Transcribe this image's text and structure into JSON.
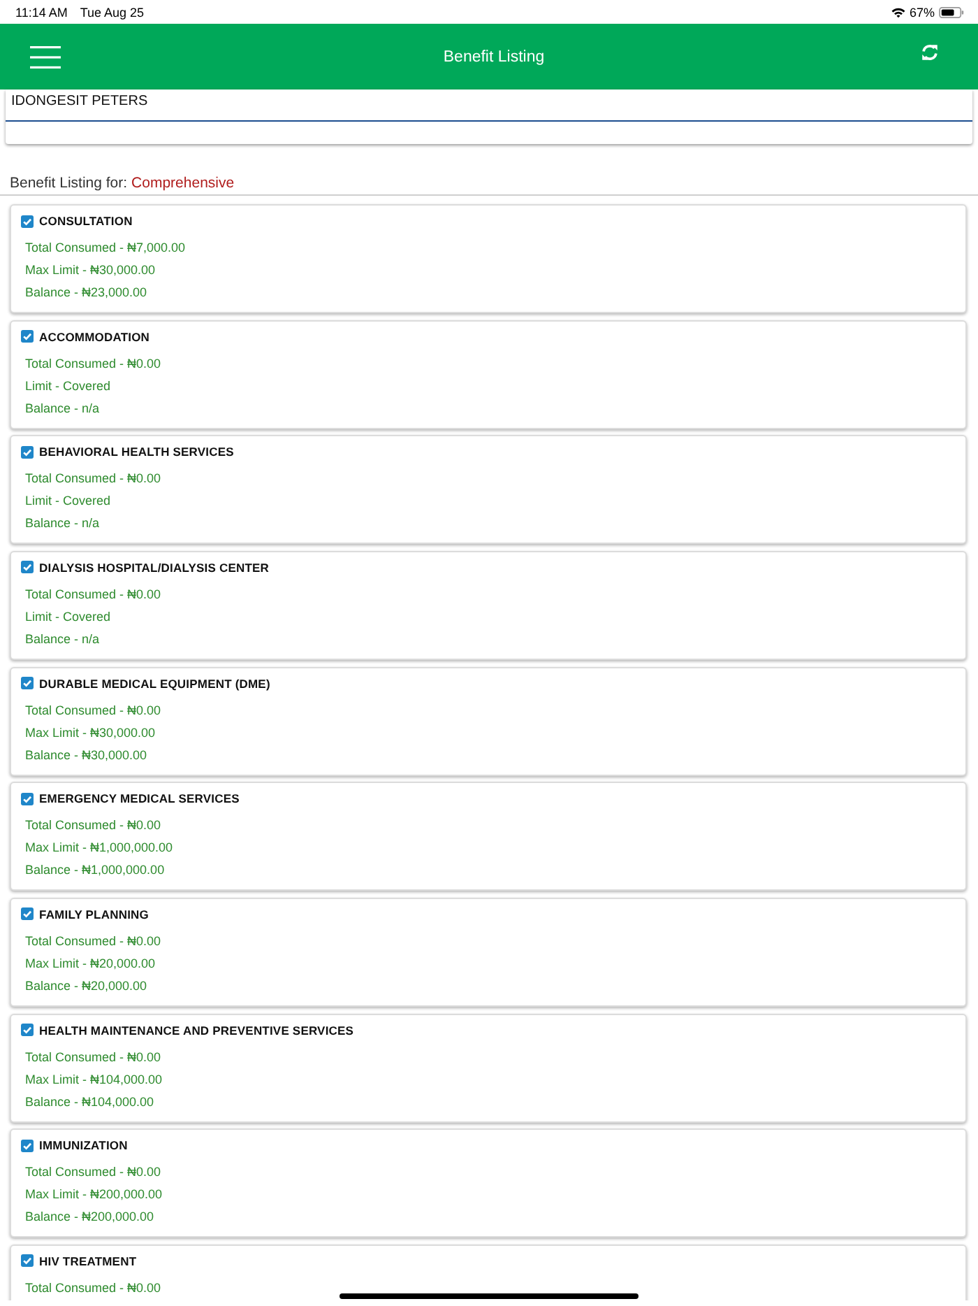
{
  "status_bar": {
    "time": "11:14 AM",
    "date": "Tue Aug 25",
    "battery": "67%"
  },
  "header": {
    "title": "Benefit Listing"
  },
  "member": {
    "name": "IDONGESIT PETERS"
  },
  "plan": {
    "label": "Benefit Listing for:",
    "value": "Comprehensive"
  },
  "benefits": [
    {
      "title": "CONSULTATION",
      "checked": true,
      "lines": [
        "Total Consumed - ₦7,000.00",
        "Max Limit - ₦30,000.00",
        "Balance - ₦23,000.00"
      ]
    },
    {
      "title": "ACCOMMODATION",
      "checked": true,
      "lines": [
        "Total Consumed - ₦0.00",
        "Limit - Covered",
        "Balance - n/a"
      ]
    },
    {
      "title": "BEHAVIORAL HEALTH SERVICES",
      "checked": true,
      "lines": [
        "Total Consumed - ₦0.00",
        "Limit - Covered",
        "Balance - n/a"
      ]
    },
    {
      "title": "DIALYSIS HOSPITAL/DIALYSIS CENTER",
      "checked": true,
      "lines": [
        "Total Consumed - ₦0.00",
        "Limit - Covered",
        "Balance - n/a"
      ]
    },
    {
      "title": "DURABLE MEDICAL EQUIPMENT (DME)",
      "checked": true,
      "lines": [
        "Total Consumed - ₦0.00",
        "Max Limit - ₦30,000.00",
        "Balance - ₦30,000.00"
      ]
    },
    {
      "title": "EMERGENCY MEDICAL SERVICES",
      "checked": true,
      "lines": [
        "Total Consumed - ₦0.00",
        "Max Limit - ₦1,000,000.00",
        "Balance - ₦1,000,000.00"
      ]
    },
    {
      "title": "FAMILY PLANNING",
      "checked": true,
      "lines": [
        "Total Consumed - ₦0.00",
        "Max Limit - ₦20,000.00",
        "Balance - ₦20,000.00"
      ]
    },
    {
      "title": "HEALTH MAINTENANCE AND PREVENTIVE SERVICES",
      "checked": true,
      "lines": [
        "Total Consumed - ₦0.00",
        "Max Limit - ₦104,000.00",
        "Balance - ₦104,000.00"
      ]
    },
    {
      "title": "IMMUNIZATION",
      "checked": true,
      "lines": [
        "Total Consumed - ₦0.00",
        "Max Limit - ₦200,000.00",
        "Balance - ₦200,000.00"
      ]
    },
    {
      "title": "HIV TREATMENT",
      "checked": true,
      "lines": [
        "Total Consumed - ₦0.00"
      ]
    }
  ]
}
